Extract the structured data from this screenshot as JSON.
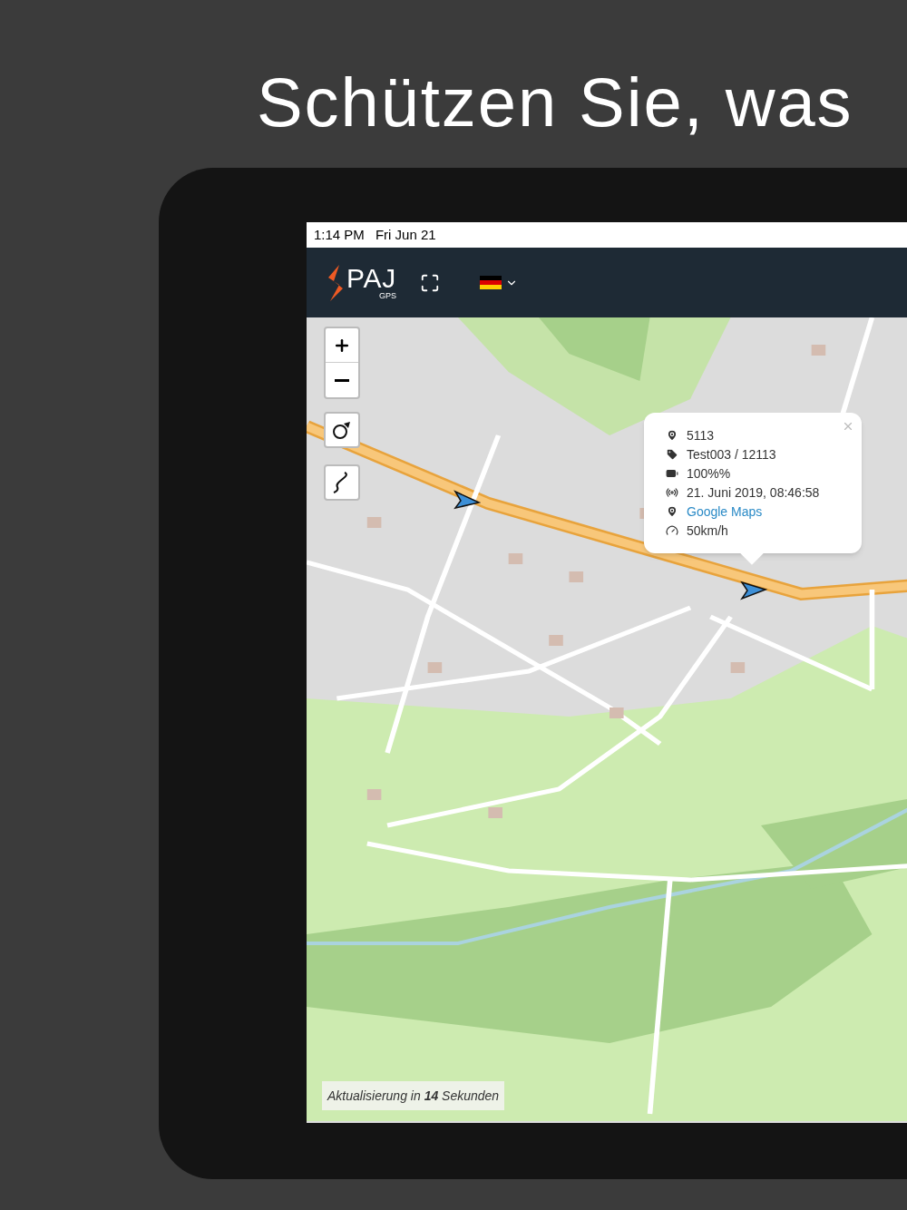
{
  "headline": "Schützen Sie, was",
  "status_bar": {
    "time": "1:14 PM",
    "date": "Fri Jun 21"
  },
  "header": {
    "logo_text": "PAJ",
    "logo_sub": "GPS"
  },
  "popup": {
    "rows": [
      {
        "kind": "pin",
        "text": "5113"
      },
      {
        "kind": "tag",
        "text": "Test003 / 12113"
      },
      {
        "kind": "battery",
        "text": "100%%"
      },
      {
        "kind": "signal",
        "text": "21. Juni 2019, 08:46:58"
      },
      {
        "kind": "link",
        "text": "Google Maps"
      },
      {
        "kind": "speed",
        "text": "50km/h"
      }
    ]
  },
  "refresh_note": "Aktualisierung in **14** Sekunden"
}
